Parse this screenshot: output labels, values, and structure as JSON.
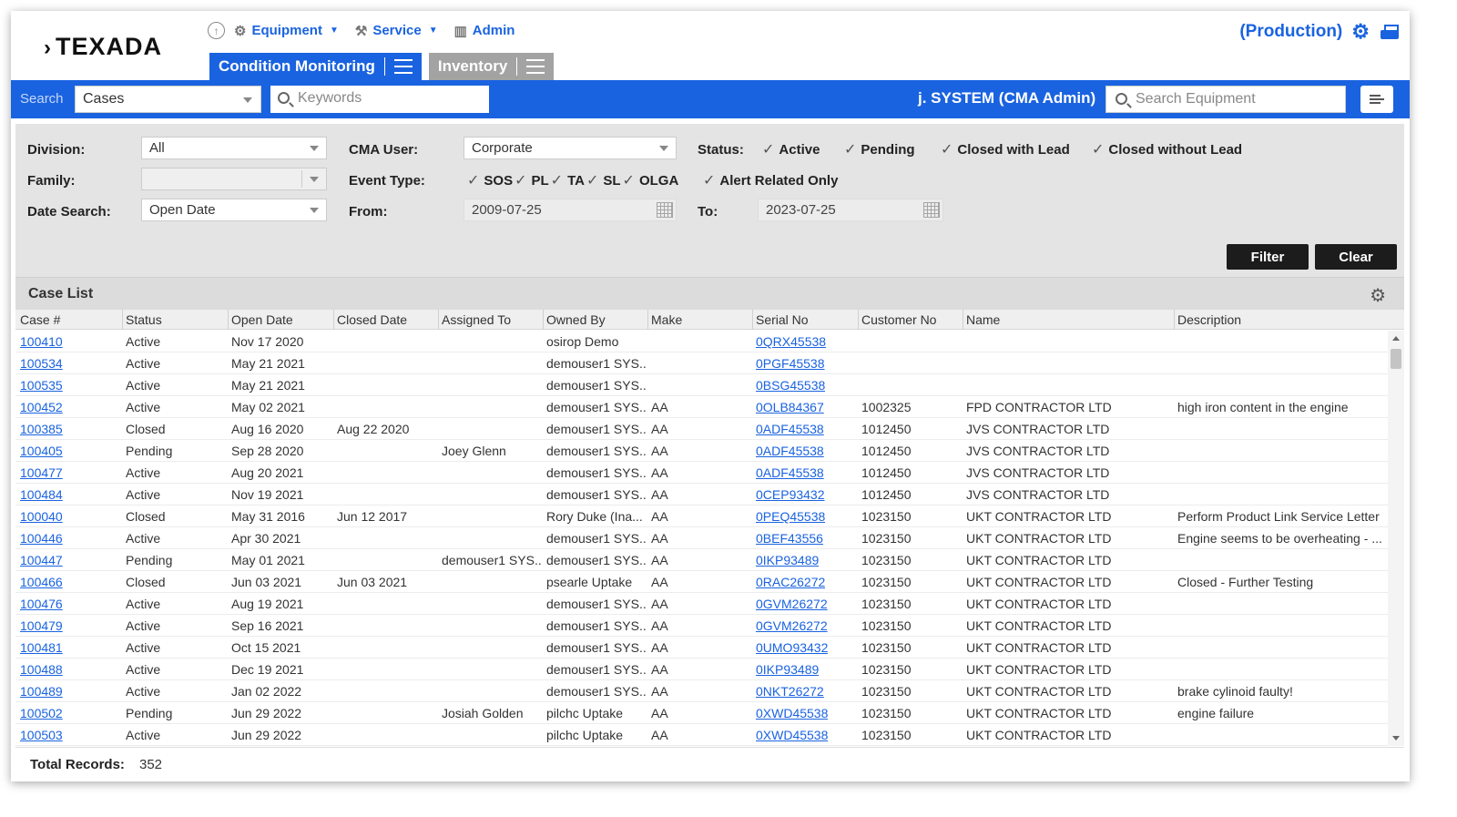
{
  "app": {
    "logo": "TEXADA",
    "environment": "(Production)"
  },
  "topnav": {
    "equipment": "Equipment",
    "service": "Service",
    "admin": "Admin"
  },
  "tabs": {
    "condition_monitoring": "Condition Monitoring",
    "inventory": "Inventory"
  },
  "searchbar": {
    "label": "Search",
    "type_value": "Cases",
    "keywords_placeholder": "Keywords",
    "user": "j. SYSTEM (CMA Admin)",
    "equipment_placeholder": "Search Equipment"
  },
  "filters": {
    "division_label": "Division:",
    "division_value": "All",
    "family_label": "Family:",
    "family_value": "",
    "date_search_label": "Date Search:",
    "date_search_value": "Open Date",
    "cma_user_label": "CMA User:",
    "cma_user_value": "Corporate",
    "event_type_label": "Event Type:",
    "event_types": [
      "SOS",
      "PL",
      "TA",
      "SL",
      "OLGA"
    ],
    "from_label": "From:",
    "from_value": "2009-07-25",
    "to_label": "To:",
    "to_value": "2023-07-25",
    "status_label": "Status:",
    "statuses": [
      "Active",
      "Pending",
      "Closed with Lead",
      "Closed without Lead"
    ],
    "alert_related": "Alert Related Only",
    "filter_button": "Filter",
    "clear_button": "Clear"
  },
  "case_list": {
    "title": "Case List",
    "columns": [
      "Case #",
      "Status",
      "Open Date",
      "Closed Date",
      "Assigned To",
      "Owned By",
      "Make",
      "Serial No",
      "Customer No",
      "Name",
      "Description"
    ],
    "rows": [
      [
        "100410",
        "Active",
        "Nov 17 2020",
        "",
        "",
        "osirop Demo",
        "",
        "0QRX45538",
        "",
        "",
        ""
      ],
      [
        "100534",
        "Active",
        "May 21 2021",
        "",
        "",
        "demouser1 SYS...",
        "",
        "0PGF45538",
        "",
        "",
        ""
      ],
      [
        "100535",
        "Active",
        "May 21 2021",
        "",
        "",
        "demouser1 SYS...",
        "",
        "0BSG45538",
        "",
        "",
        ""
      ],
      [
        "100452",
        "Active",
        "May 02 2021",
        "",
        "",
        "demouser1 SYS...",
        "AA",
        "0OLB84367",
        "1002325",
        "FPD CONTRACTOR LTD",
        "high iron content in the engine"
      ],
      [
        "100385",
        "Closed",
        "Aug 16 2020",
        "Aug 22 2020",
        "",
        "demouser1 SYS...",
        "AA",
        "0ADF45538",
        "1012450",
        "JVS CONTRACTOR LTD",
        ""
      ],
      [
        "100405",
        "Pending",
        "Sep 28 2020",
        "",
        "Joey Glenn",
        "demouser1 SYS...",
        "AA",
        "0ADF45538",
        "1012450",
        "JVS CONTRACTOR LTD",
        ""
      ],
      [
        "100477",
        "Active",
        "Aug 20 2021",
        "",
        "",
        "demouser1 SYS...",
        "AA",
        "0ADF45538",
        "1012450",
        "JVS CONTRACTOR LTD",
        ""
      ],
      [
        "100484",
        "Active",
        "Nov 19 2021",
        "",
        "",
        "demouser1 SYS...",
        "AA",
        "0CEP93432",
        "1012450",
        "JVS CONTRACTOR LTD",
        ""
      ],
      [
        "100040",
        "Closed",
        "May 31 2016",
        "Jun 12 2017",
        "",
        "Rory Duke (Ina...",
        "AA",
        "0PEQ45538",
        "1023150",
        "UKT CONTRACTOR LTD",
        "Perform Product Link Service Letter"
      ],
      [
        "100446",
        "Active",
        "Apr 30 2021",
        "",
        "",
        "demouser1 SYS...",
        "AA",
        "0BEF43556",
        "1023150",
        "UKT CONTRACTOR LTD",
        "Engine seems to be overheating - ..."
      ],
      [
        "100447",
        "Pending",
        "May 01 2021",
        "",
        "demouser1 SYS...",
        "demouser1 SYS...",
        "AA",
        "0IKP93489",
        "1023150",
        "UKT CONTRACTOR LTD",
        ""
      ],
      [
        "100466",
        "Closed",
        "Jun 03 2021",
        "Jun 03 2021",
        "",
        "psearle Uptake",
        "AA",
        "0RAC26272",
        "1023150",
        "UKT CONTRACTOR LTD",
        "Closed - Further Testing"
      ],
      [
        "100476",
        "Active",
        "Aug 19 2021",
        "",
        "",
        "demouser1 SYS...",
        "AA",
        "0GVM26272",
        "1023150",
        "UKT CONTRACTOR LTD",
        ""
      ],
      [
        "100479",
        "Active",
        "Sep 16 2021",
        "",
        "",
        "demouser1 SYS...",
        "AA",
        "0GVM26272",
        "1023150",
        "UKT CONTRACTOR LTD",
        ""
      ],
      [
        "100481",
        "Active",
        "Oct 15 2021",
        "",
        "",
        "demouser1 SYS...",
        "AA",
        "0UMO93432",
        "1023150",
        "UKT CONTRACTOR LTD",
        ""
      ],
      [
        "100488",
        "Active",
        "Dec 19 2021",
        "",
        "",
        "demouser1 SYS...",
        "AA",
        "0IKP93489",
        "1023150",
        "UKT CONTRACTOR LTD",
        ""
      ],
      [
        "100489",
        "Active",
        "Jan 02 2022",
        "",
        "",
        "demouser1 SYS...",
        "AA",
        "0NKT26272",
        "1023150",
        "UKT CONTRACTOR LTD",
        "brake cylinoid faulty!"
      ],
      [
        "100502",
        "Pending",
        "Jun 29 2022",
        "",
        "Josiah Golden",
        "pilchc Uptake",
        "AA",
        "0XWD45538",
        "1023150",
        "UKT CONTRACTOR LTD",
        "engine failure"
      ],
      [
        "100503",
        "Active",
        "Jun 29 2022",
        "",
        "",
        "pilchc Uptake",
        "AA",
        "0XWD45538",
        "1023150",
        "UKT CONTRACTOR LTD",
        ""
      ]
    ],
    "total_label": "Total Records:",
    "total_value": "352"
  },
  "icons": [
    "up-circle-icon",
    "equipment-gears-icon",
    "wrench-icon",
    "admin-grid-icon",
    "gear-icon",
    "print-icon",
    "hamburger-icon",
    "search-icon",
    "calendar-icon",
    "checkbox-icon",
    "hide-columns-icon"
  ],
  "colors": {
    "primary": "#1a63e0",
    "inactive_tab": "#a3a3a3",
    "button_dark": "#1c1c1c",
    "panel": "#e4e4e4"
  }
}
